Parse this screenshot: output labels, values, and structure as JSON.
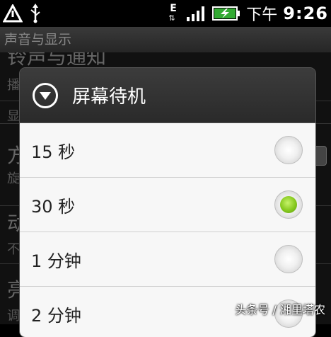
{
  "status_bar": {
    "network": "E",
    "ampm": "下午",
    "time": "9:26"
  },
  "background": {
    "title": "声音与显示",
    "item1_label": "铃声与通知",
    "item1_sub": "播",
    "section_label": "显",
    "item2_label": "方",
    "item2_sub": "旋",
    "item3_label": "动",
    "item3_sub": "不",
    "item4_label": "亮",
    "item4_sub": "调"
  },
  "dialog": {
    "title": "屏幕待机",
    "options": [
      {
        "label": "15 秒",
        "checked": false
      },
      {
        "label": "30 秒",
        "checked": true
      },
      {
        "label": "1 分钟",
        "checked": false
      },
      {
        "label": "2 分钟",
        "checked": false
      }
    ]
  },
  "watermark": "头条号 / 湘里塔农"
}
